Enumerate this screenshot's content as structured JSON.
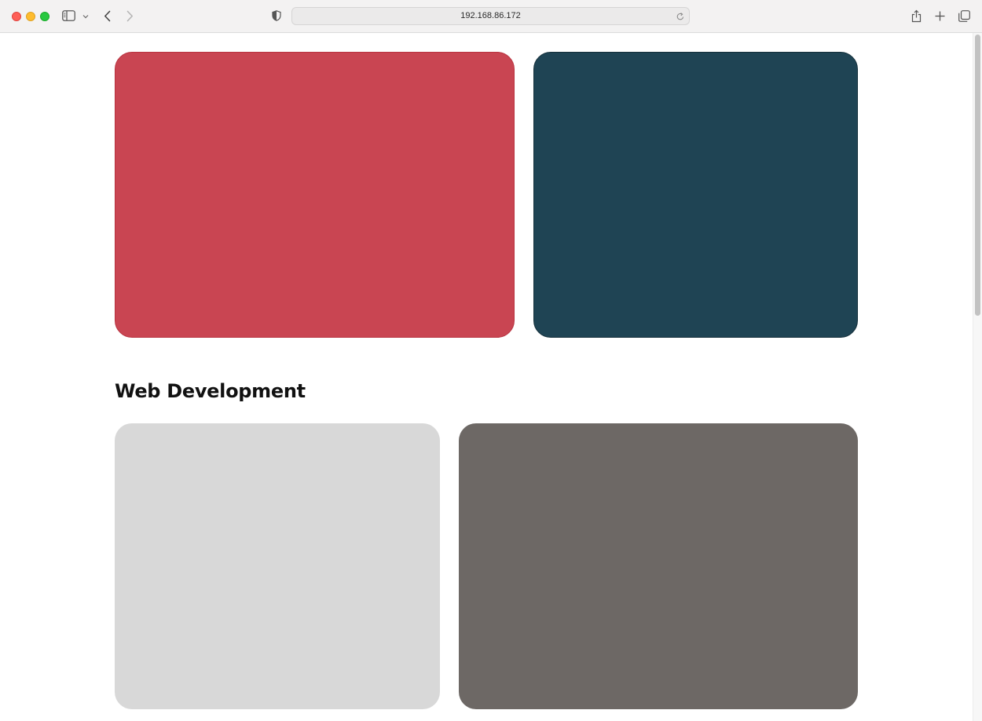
{
  "browser": {
    "url": "192.168.86.172",
    "icons": {
      "sidebar": "sidebar-toggle-icon",
      "sidebar_menu": "chevron-down-icon",
      "back": "back-arrow-icon",
      "forward": "forward-arrow-icon",
      "privacy": "shield-icon",
      "reload": "reload-icon",
      "share": "share-icon",
      "new_tab": "plus-icon",
      "tabs": "tab-overview-icon"
    }
  },
  "page": {
    "sections": [
      {
        "cards": [
          {
            "color": "#c94552"
          },
          {
            "color": "#1f4454"
          }
        ]
      },
      {
        "title": "Web Development",
        "cards": [
          {
            "color": "#d8d8d8"
          },
          {
            "color": "#6d6865"
          }
        ]
      }
    ]
  },
  "scrollbar": {
    "position_fraction": 0.0,
    "visible_fraction": 0.41
  }
}
